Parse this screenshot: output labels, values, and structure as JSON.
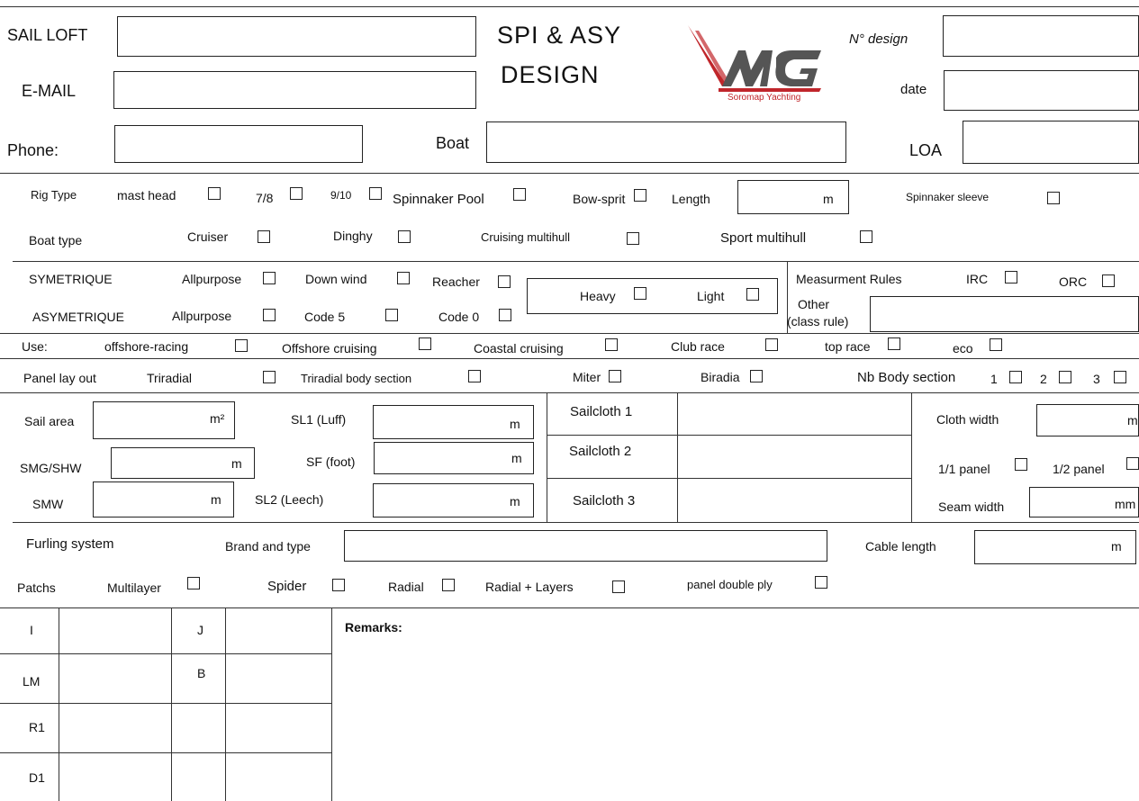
{
  "header": {
    "sail_loft": "SAIL LOFT",
    "email": "E-MAIL",
    "phone": "Phone:",
    "title_line1": "SPI & ASY",
    "title_line2": "DESIGN",
    "logo_text": "Soromap Yachting",
    "n_design": "N° design",
    "date": "date",
    "boat": "Boat",
    "loa": "LOA"
  },
  "rig": {
    "rig_type": "Rig Type",
    "mast_head": "mast head",
    "seven_eighths": "7/8",
    "nine_tenths": "9/10",
    "spinnaker_pool": "Spinnaker Pool",
    "bow_sprit": "Bow-sprit",
    "length": "Length",
    "length_unit": "m",
    "spinnaker_sleeve": "Spinnaker sleeve"
  },
  "boat_type": {
    "label": "Boat type",
    "cruiser": "Cruiser",
    "dinghy": "Dinghy",
    "cruising_multihull": "Cruising multihull",
    "sport_multihull": "Sport multihull"
  },
  "sail_type": {
    "symetrique": "SYMETRIQUE",
    "asymetrique": "ASYMETRIQUE",
    "allpurpose_sym": "Allpurpose",
    "down_wind": "Down wind",
    "reacher": "Reacher",
    "allpurpose_asy": "Allpurpose",
    "code5": "Code 5",
    "code0": "Code 0",
    "heavy": "Heavy",
    "light": "Light",
    "measurement_rules": "Measurment Rules",
    "irc": "IRC",
    "orc": "ORC",
    "other": "Other",
    "class_rule": "(class rule)"
  },
  "use": {
    "label": "Use:",
    "offshore_racing": "offshore-racing",
    "offshore_cruising": "Offshore cruising",
    "coastal_cruising": "Coastal cruising",
    "club_race": "Club race",
    "top_race": "top race",
    "eco": "eco"
  },
  "panel": {
    "label": "Panel lay out",
    "triradial": "Triradial",
    "triradial_body": "Triradial body section",
    "miter": "Miter",
    "biradia": "Biradia",
    "nb_body": "Nb Body section",
    "n1": "1",
    "n2": "2",
    "n3": "3"
  },
  "dims": {
    "sail_area": "Sail area",
    "sail_area_unit": "m²",
    "smg": "SMG/SHW",
    "smg_unit": "m",
    "smw": "SMW",
    "smw_unit": "m",
    "sl1": "SL1 (Luff)",
    "sl1_unit": "m",
    "sf": "SF (foot)",
    "sf_unit": "m",
    "sl2": "SL2 (Leech)",
    "sl2_unit": "m",
    "sailcloth1": "Sailcloth 1",
    "sailcloth2": "Sailcloth 2",
    "sailcloth3": "Sailcloth 3",
    "cloth_width": "Cloth width",
    "cloth_width_unit": "m",
    "panel_full": "1/1 panel",
    "panel_half": "1/2 panel",
    "seam_width": "Seam width",
    "seam_width_unit": "mm"
  },
  "furling": {
    "label": "Furling system",
    "brand": "Brand and type",
    "cable": "Cable length",
    "cable_unit": "m"
  },
  "patchs": {
    "label": "Patchs",
    "multilayer": "Multilayer",
    "spider": "Spider",
    "radial": "Radial",
    "radial_layers": "Radial + Layers",
    "panel_double": "panel double ply"
  },
  "measures": {
    "i": "I",
    "j": "J",
    "lm": "LM",
    "b": "B",
    "r1": "R1",
    "d1": "D1",
    "remarks": "Remarks:"
  },
  "colors": {
    "logo_red": "#c0262b",
    "logo_gray": "#555555"
  }
}
